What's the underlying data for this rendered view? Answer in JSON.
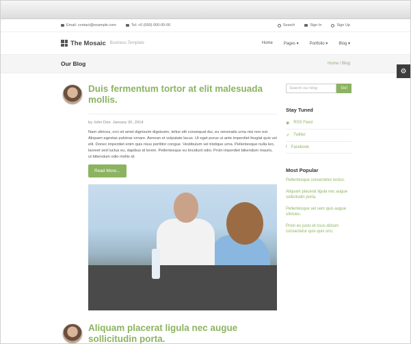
{
  "topbar": {
    "email": "Email: contact@example.com",
    "tel": "Tel: +0 (000) 000-00-00",
    "search": "Search",
    "signin": "Sign In",
    "signup": "Sign Up"
  },
  "brand": {
    "name": "The Mosaic",
    "tagline": "Business Template"
  },
  "nav": {
    "home": "Home",
    "pages": "Pages ▾",
    "portfolio": "Portfolio ▾",
    "blog": "Blog ▾"
  },
  "pagebar": {
    "title": "Our Blog",
    "crumb_home": "Home",
    "crumb_sep": "/",
    "crumb_current": "Blog"
  },
  "post1": {
    "title": "Duis fermentum tortor at elit malesuada mollis.",
    "meta": "by John Doe. January 30, 2014",
    "excerpt": "Nam ultrices, orci sit amet dignissim dignissim, tellus elit consequat dui, eu venenatis urna nisi non est. Aliquam egestas pulvinar ornare. Aenean et vulputate lacus. Ut eget purus ut ante imperdiet feugiat quis vel elit. Donec imperdiet enim quis risus porttitor congue. Vestibulum vel tristique urna. Pellentesque nulla leo, laoreet sed luctus eu, dapibus id lorem. Pellentesque eu tincidunt odio. Proin imperdiet bibendum mauris, ut bibendum odio mollis id.",
    "button": "Read More..."
  },
  "post2": {
    "title": "Aliquam placerat ligula nec augue sollicitudin porta."
  },
  "sidebar": {
    "search_placeholder": "Search our blog",
    "search_button": "Go!",
    "stay_title": "Stay Tuned",
    "rss": "RSS Feed",
    "twitter": "Twitter",
    "facebook": "Facebook",
    "popular_title": "Most Popular",
    "popular": [
      "Pellentesque consectetur lectus.",
      "Aliquam placerat ligula nec augue sollicitudin porta.",
      "Pellentesque vel sem quis augue ultricies.",
      "Proin eu justo et risus dictum consectetur quis quis orci."
    ]
  },
  "colors": {
    "accent": "#8cb360"
  }
}
